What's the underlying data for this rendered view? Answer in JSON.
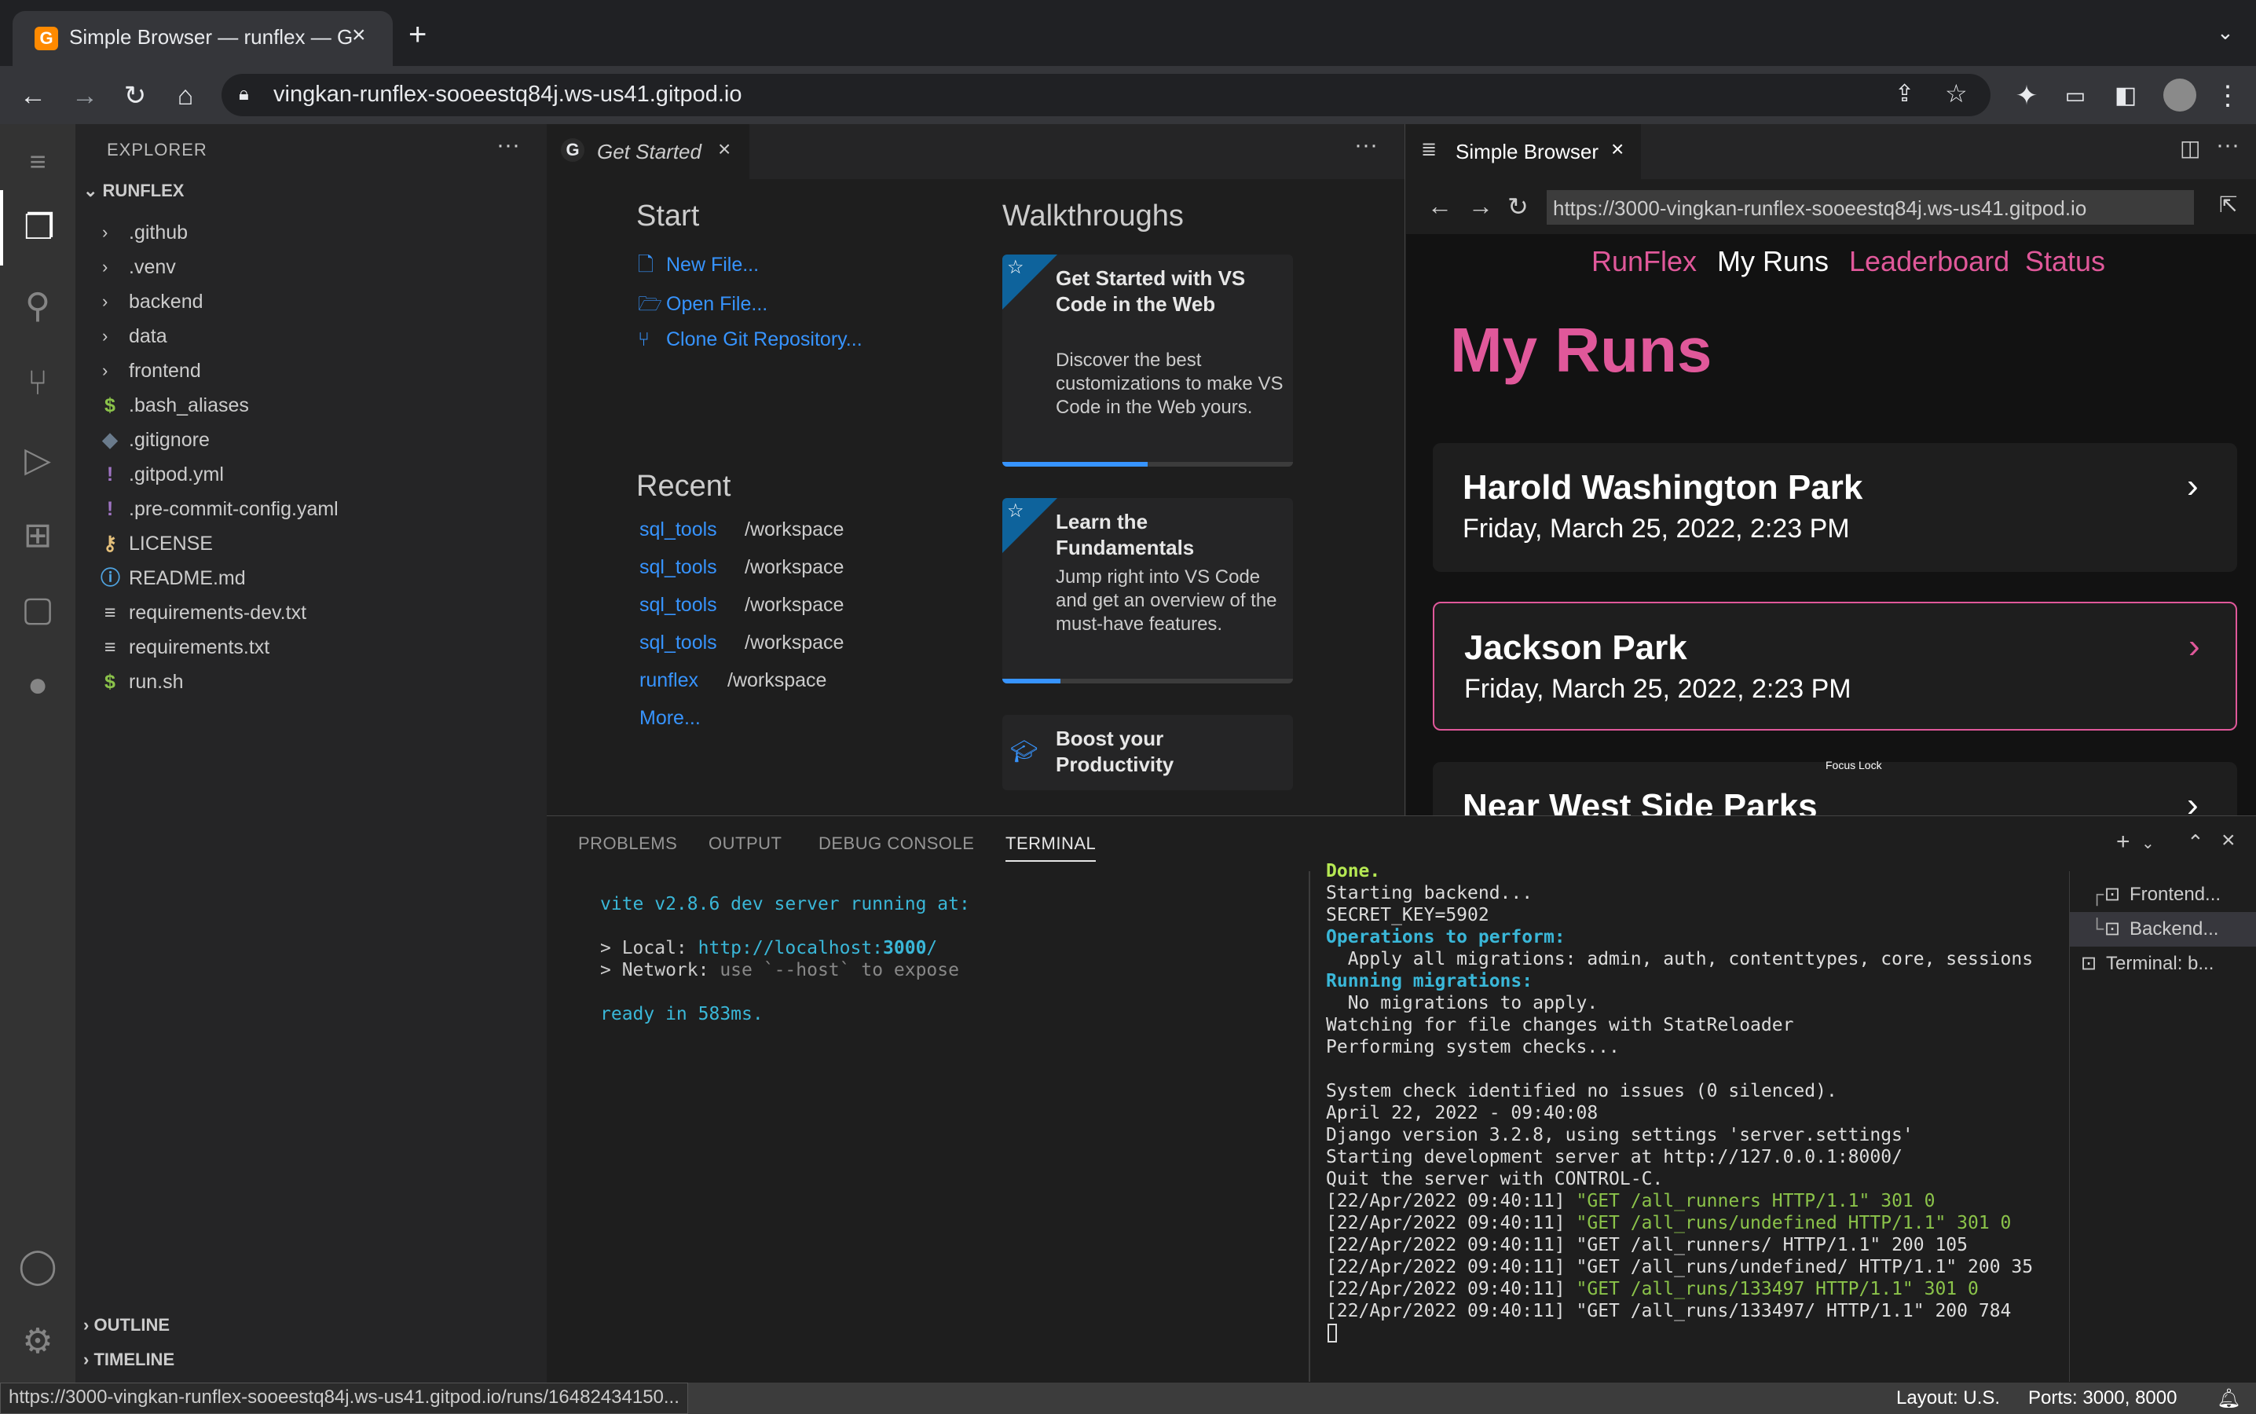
{
  "browser": {
    "tab_title": "Simple Browser — runflex — G",
    "url": "vingkan-runflex-sooeestq84j.ws-us41.gitpod.io"
  },
  "explorer": {
    "header": "EXPLORER",
    "section": "RUNFLEX",
    "items": [
      {
        "label": ".github",
        "type": "folder"
      },
      {
        "label": ".venv",
        "type": "folder"
      },
      {
        "label": "backend",
        "type": "folder"
      },
      {
        "label": "data",
        "type": "folder"
      },
      {
        "label": "frontend",
        "type": "folder"
      },
      {
        "label": ".bash_aliases",
        "type": "file",
        "icon": "$"
      },
      {
        "label": ".gitignore",
        "type": "file",
        "icon": "◆"
      },
      {
        "label": ".gitpod.yml",
        "type": "file",
        "icon": "!"
      },
      {
        "label": ".pre-commit-config.yaml",
        "type": "file",
        "icon": "!"
      },
      {
        "label": "LICENSE",
        "type": "file",
        "icon": "⚷"
      },
      {
        "label": "README.md",
        "type": "file",
        "icon": "ⓘ"
      },
      {
        "label": "requirements-dev.txt",
        "type": "file",
        "icon": "≡"
      },
      {
        "label": "requirements.txt",
        "type": "file",
        "icon": "≡"
      },
      {
        "label": "run.sh",
        "type": "file",
        "icon": "$"
      }
    ],
    "outline": "OUTLINE",
    "timeline": "TIMELINE"
  },
  "editor1": {
    "tab_label": "Get Started",
    "start": {
      "heading": "Start",
      "links": [
        "New File...",
        "Open File...",
        "Clone Git Repository..."
      ]
    },
    "recent": {
      "heading": "Recent",
      "items": [
        {
          "name": "sql_tools",
          "path": "/workspace"
        },
        {
          "name": "sql_tools",
          "path": "/workspace"
        },
        {
          "name": "sql_tools",
          "path": "/workspace"
        },
        {
          "name": "sql_tools",
          "path": "/workspace"
        },
        {
          "name": "runflex",
          "path": "/workspace"
        }
      ],
      "more": "More..."
    },
    "walkthroughs": {
      "heading": "Walkthroughs",
      "cards": [
        {
          "title": "Get Started with VS Code in the Web",
          "desc": "Discover the best customizations to make VS Code in the Web yours.",
          "progress": 0.5
        },
        {
          "title": "Learn the Fundamentals",
          "desc": "Jump right into VS Code and get an overview of the must-have features.",
          "progress": 0.2
        },
        {
          "title": "Boost your Productivity"
        }
      ]
    }
  },
  "editor2": {
    "tab_label": "Simple Browser",
    "url": "https://3000-vingkan-runflex-sooeestq84j.ws-us41.gitpod.io",
    "page": {
      "nav": [
        "RunFlex",
        "My Runs",
        "Leaderboard",
        "Status"
      ],
      "title": "My Runs",
      "runs": [
        {
          "name": "Harold Washington Park",
          "date": "Friday, March 25, 2022, 2:23 PM"
        },
        {
          "name": "Jackson Park",
          "date": "Friday, March 25, 2022, 2:23 PM"
        },
        {
          "name": "Near West Side Parks",
          "date": ""
        }
      ],
      "focus_lock": "Focus Lock"
    }
  },
  "panel": {
    "tabs": [
      "PROBLEMS",
      "OUTPUT",
      "DEBUG CONSOLE",
      "TERMINAL"
    ],
    "terminal_left": {
      "line1": "vite v2.8.6 dev server running at:",
      "local_label": "> Local: ",
      "local_url": "http://localhost:",
      "local_port": "3000",
      "local_slash": "/",
      "network": "> Network: ",
      "network_hint": "use `--host` to expose",
      "ready": "ready in 583ms."
    },
    "terminal_right": {
      "lines": [
        {
          "text": "Done.",
          "style": "done"
        },
        {
          "text": "Starting backend...",
          "style": "plain"
        },
        {
          "text": "SECRET_KEY=5902",
          "style": "plain"
        },
        {
          "text": "Operations to perform:",
          "style": "cyanbold"
        },
        {
          "text": "  Apply all migrations: admin, auth, contenttypes, core, sessions",
          "style": "applybold"
        },
        {
          "text": "Running migrations:",
          "style": "cyanbold"
        },
        {
          "text": "  No migrations to apply.",
          "style": "plain"
        },
        {
          "text": "Watching for file changes with StatReloader",
          "style": "plain"
        },
        {
          "text": "Performing system checks...",
          "style": "plain"
        },
        {
          "text": "",
          "style": "plain"
        },
        {
          "text": "System check identified no issues (0 silenced).",
          "style": "plain"
        },
        {
          "text": "April 22, 2022 - 09:40:08",
          "style": "plain"
        },
        {
          "text": "Django version 3.2.8, using settings 'server.settings'",
          "style": "plain"
        },
        {
          "text": "Starting development server at http://127.0.0.1:8000/",
          "style": "plain"
        },
        {
          "text": "Quit the server with CONTROL-C.",
          "style": "plain"
        },
        {
          "prefix": "[22/Apr/2022 09:40:11] ",
          "text": "\"GET /all_runners HTTP/1.1\" 301 0",
          "style": "green"
        },
        {
          "prefix": "[22/Apr/2022 09:40:11] ",
          "text": "\"GET /all_runs/undefined HTTP/1.1\" 301 0",
          "style": "green"
        },
        {
          "prefix": "[22/Apr/2022 09:40:11] ",
          "text": "\"GET /all_runners/ HTTP/1.1\" 200 105",
          "style": "plain"
        },
        {
          "prefix": "[22/Apr/2022 09:40:11] ",
          "text": "\"GET /all_runs/undefined/ HTTP/1.1\" 200 35",
          "style": "plain"
        },
        {
          "prefix": "[22/Apr/2022 09:40:11] ",
          "text": "\"GET /all_runs/133497 HTTP/1.1\" 301 0",
          "style": "green"
        },
        {
          "prefix": "[22/Apr/2022 09:40:11] ",
          "text": "\"GET /all_runs/133497/ HTTP/1.1\" 200 784",
          "style": "plain"
        }
      ]
    },
    "terminal_list": [
      "Frontend...",
      "Backend...",
      "Terminal: b..."
    ]
  },
  "status": {
    "link_hover": "https://3000-vingkan-runflex-sooeestq84j.ws-us41.gitpod.io/runs/16482434150...",
    "layout": "Layout: U.S.",
    "ports": "Ports: 3000, 8000"
  },
  "colors": {
    "accent_pink": "#e0589a",
    "link_blue": "#3794ff",
    "terminal_green": "#8bc34a",
    "terminal_cyan": "#3ab7d8"
  }
}
